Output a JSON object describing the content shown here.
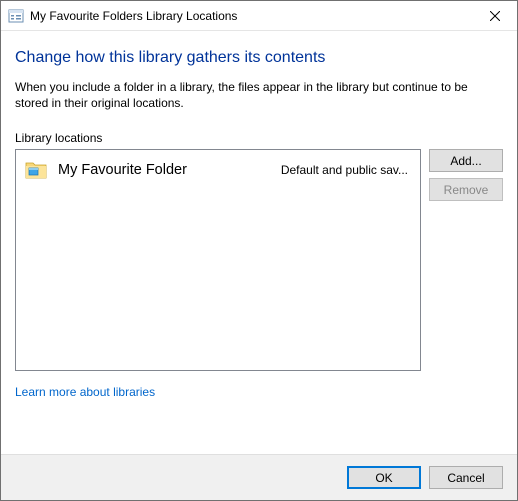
{
  "titlebar": {
    "title": "My Favourite Folders Library Locations"
  },
  "heading": "Change how this library gathers its contents",
  "description": "When you include a folder in a library, the files appear in the library but continue to be stored in their original locations.",
  "list_label": "Library locations",
  "items": [
    {
      "name": "My Favourite Folder",
      "status": "Default and public sav..."
    }
  ],
  "buttons": {
    "add": "Add...",
    "remove": "Remove",
    "ok": "OK",
    "cancel": "Cancel"
  },
  "link": "Learn more about libraries"
}
